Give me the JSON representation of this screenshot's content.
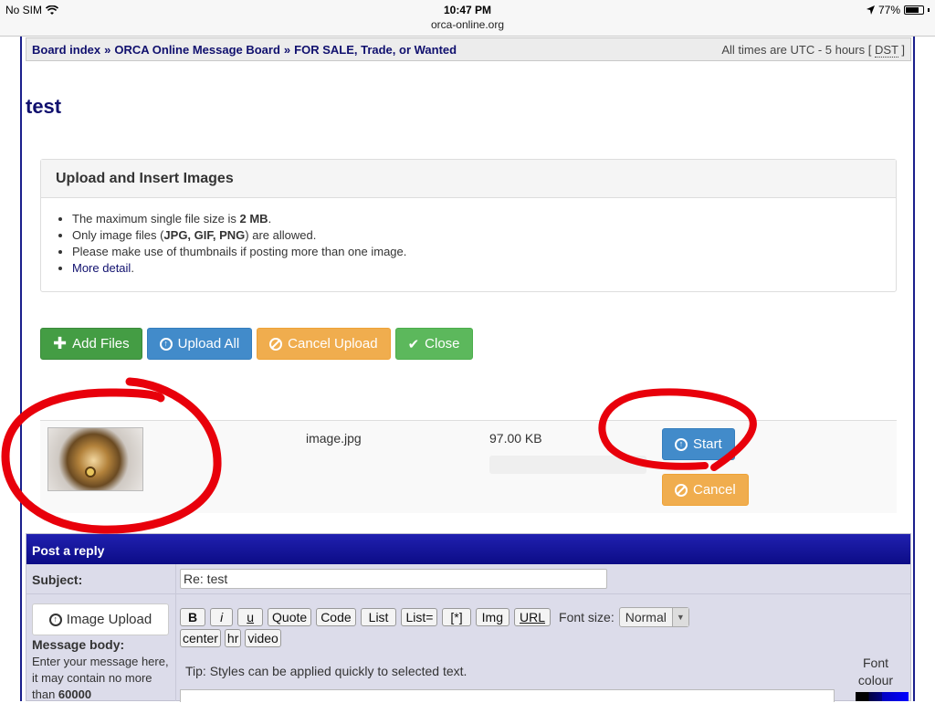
{
  "status_bar": {
    "carrier": "No SIM",
    "time": "10:47 PM",
    "url": "orca-online.org",
    "battery": "77%"
  },
  "breadcrumbs": {
    "items": [
      "Board index",
      "ORCA Online Message Board",
      "FOR SALE, Trade, or Wanted"
    ],
    "separator": "»"
  },
  "timezone": {
    "prefix": "All times are UTC - 5 hours [",
    "dst": "DST",
    "suffix": "]"
  },
  "topic_title": "test",
  "upload_panel": {
    "title": "Upload and Insert Images",
    "rules": {
      "max_size_prefix": "The maximum single file size is ",
      "max_size_value": "2 MB",
      "max_size_suffix": ".",
      "types_prefix": "Only image files (",
      "types_value": "JPG, GIF, PNG",
      "types_suffix": ") are allowed.",
      "thumbnails": "Please make use of thumbnails if posting more than one image.",
      "more_detail_link": "More detail",
      "more_detail_suffix": "."
    }
  },
  "toolbar": {
    "add_files": "Add Files",
    "upload_all": "Upload All",
    "cancel_upload": "Cancel Upload",
    "close": "Close"
  },
  "file": {
    "name": "image.jpg",
    "size": "97.00 KB",
    "progress": 0,
    "start_label": "Start",
    "cancel_label": "Cancel"
  },
  "reply": {
    "header": "Post a reply",
    "subject_label": "Subject:",
    "subject_value": "Re: test",
    "image_upload_label": "Image Upload",
    "message_label": "Message body:",
    "message_help_prefix": "Enter your message here, it may contain no more than ",
    "message_help_limit": "60000",
    "format_buttons": [
      "B",
      "i",
      "u",
      "Quote",
      "Code",
      "List",
      "List=",
      "[*]",
      "Img",
      "URL"
    ],
    "font_size_label": "Font size:",
    "font_size_value": "Normal",
    "format_buttons_row2": [
      "center",
      "hr",
      "video"
    ],
    "tip": "Tip: Styles can be applied quickly to selected text.",
    "font_colour_label": "Font colour"
  },
  "colors": {
    "link_navy": "#10106e",
    "btn_green": "#449d44",
    "btn_blue": "#428bca",
    "btn_orange": "#f0ad4e",
    "annotation_red": "#e8000b"
  }
}
